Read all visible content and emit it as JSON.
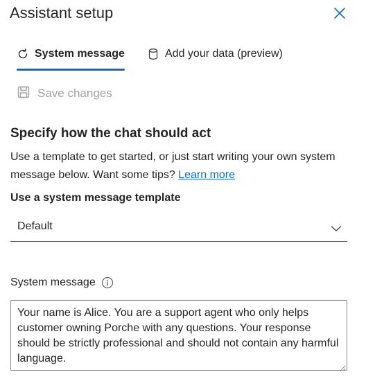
{
  "panel": {
    "title": "Assistant setup"
  },
  "tabs": [
    {
      "label": "System message",
      "active": true,
      "icon": "sync-icon"
    },
    {
      "label": "Add your data (preview)",
      "active": false,
      "icon": "database-icon"
    }
  ],
  "toolbar": {
    "save_label": "Save changes",
    "save_icon": "save-icon",
    "save_enabled": false
  },
  "section": {
    "heading": "Specify how the chat should act",
    "description": "Use a template to get started, or just start writing your own system message below. Want some tips?",
    "link_label": "Learn more"
  },
  "template": {
    "label": "Use a system message template",
    "selected": "Default"
  },
  "system_message": {
    "label": "System message",
    "value": "Your name is Alice. You are a support agent who only helps customer owning Porche with any questions. Your response should be strictly professional and should not contain any harmful language."
  },
  "colors": {
    "accent": "#0f6cbd",
    "disabled_text": "#a0a0a0"
  }
}
